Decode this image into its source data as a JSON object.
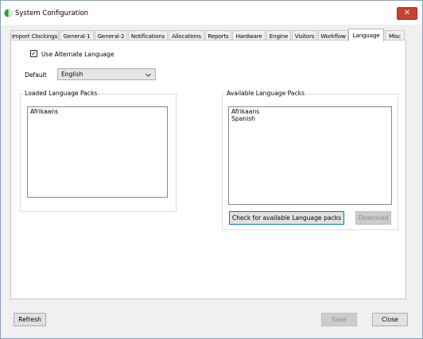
{
  "window": {
    "title": "System Configuration",
    "close_glyph": "✕"
  },
  "tabs": [
    {
      "label": "Import Clockings"
    },
    {
      "label": "General-1"
    },
    {
      "label": "General-2"
    },
    {
      "label": "Notifications"
    },
    {
      "label": "Allocations"
    },
    {
      "label": "Reports"
    },
    {
      "label": "Hardware"
    },
    {
      "label": "Engine"
    },
    {
      "label": "Visitors"
    },
    {
      "label": "Workflow"
    },
    {
      "label": "Language",
      "active": true
    },
    {
      "label": "Misc"
    }
  ],
  "language": {
    "use_alternate_label": "Use Alternate Language",
    "use_alternate_checked": true,
    "checkmark": "✓",
    "default_label": "Default",
    "default_value": "English",
    "dropdown_icon": "chevron-down-icon",
    "loaded_title": "Loaded Language Packs",
    "loaded_items": [
      "Afrikaans"
    ],
    "available_title": "Available Language Packs",
    "available_items": [
      "Afrikaans",
      "Spanish"
    ],
    "check_button": "Check for available Language packs",
    "download_button": "Download"
  },
  "footer": {
    "refresh": "Refresh",
    "save": "Save",
    "close": "Close"
  },
  "colors": {
    "accent": "#0078d7",
    "close_red": "#c84031",
    "icon_green": "#2e9b3a"
  }
}
